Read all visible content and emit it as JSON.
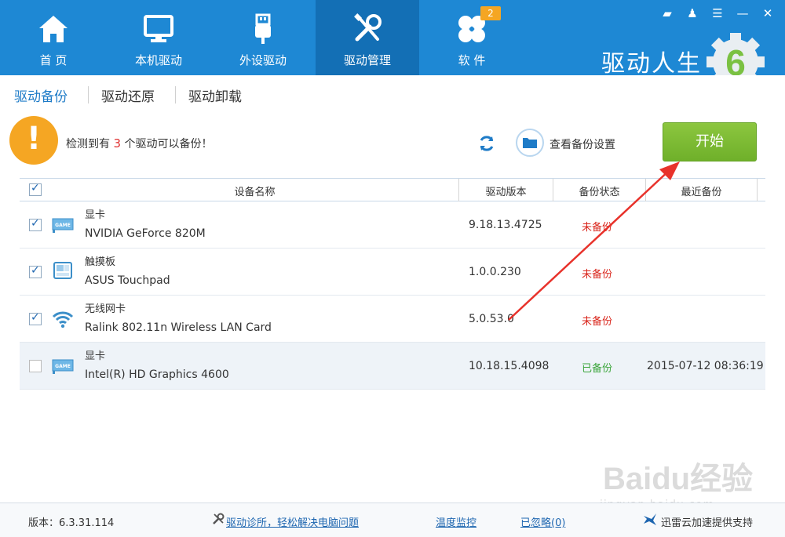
{
  "header": {
    "nav": [
      {
        "label": "首 页",
        "icon": "home-icon"
      },
      {
        "label": "本机驱动",
        "icon": "monitor-icon"
      },
      {
        "label": "外设驱动",
        "icon": "usb-icon"
      },
      {
        "label": "驱动管理",
        "icon": "tools-icon"
      },
      {
        "label": "软 件",
        "icon": "software-icon",
        "badge": "2"
      }
    ],
    "brand": "驱动人生",
    "brand_logo_digit": "6",
    "colors": {
      "header_bg": "#1e88d4",
      "active_tab": "#136fb5",
      "badge": "#f5a623"
    }
  },
  "subtabs": [
    "驱动备份",
    "驱动还原",
    "驱动卸载"
  ],
  "info": {
    "prefix": "检测到有",
    "count": "3",
    "suffix": "个驱动可以备份！",
    "settings_label": "查看备份设置",
    "start_label": "开始"
  },
  "table": {
    "headers": [
      "设备名称",
      "驱动版本",
      "备份状态",
      "最近备份"
    ],
    "rows": [
      {
        "type": "显卡",
        "name": "NVIDIA GeForce 820M",
        "version": "9.18.13.4725",
        "status": "未备份",
        "date": "",
        "checked": true,
        "icon": "graphics-card-icon"
      },
      {
        "type": "触摸板",
        "name": "ASUS Touchpad",
        "version": "1.0.0.230",
        "status": "未备份",
        "date": "",
        "checked": true,
        "icon": "touchpad-icon"
      },
      {
        "type": "无线网卡",
        "name": "Ralink 802.11n Wireless LAN Card",
        "version": "5.0.53.0",
        "status": "未备份",
        "date": "",
        "checked": true,
        "icon": "wifi-icon"
      },
      {
        "type": "显卡",
        "name": "Intel(R) HD Graphics 4600",
        "version": "10.18.15.4098",
        "status": "已备份",
        "date": "2015-07-12 08:36:19",
        "checked": false,
        "icon": "graphics-card-icon"
      }
    ]
  },
  "footer": {
    "version": "版本：6.3.31.114",
    "diag_link": "驱动诊所，轻松解决电脑问题",
    "temp_link": "温度监控",
    "ignored_link": "已忽略(0)",
    "support": "迅雷云加速提供支持"
  },
  "watermark": {
    "main": "Baidu经验",
    "sub": "jingyan.baidu.com"
  }
}
